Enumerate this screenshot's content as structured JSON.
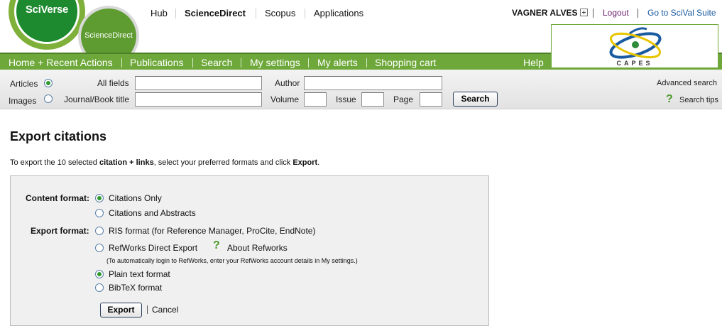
{
  "logos": {
    "sciverse": "SciVerse",
    "sciencedirect": "ScienceDirect",
    "capes": "CAPES"
  },
  "topnav": {
    "items": [
      "Hub",
      "ScienceDirect",
      "Scopus",
      "Applications"
    ],
    "active": "ScienceDirect"
  },
  "user": {
    "name": "VAGNER ALVES",
    "expand_icon": "plus-box-icon",
    "logout": "Logout",
    "scival": "Go to SciVal Suite"
  },
  "menu": {
    "items": [
      "Home + Recent Actions",
      "Publications",
      "Search",
      "My settings",
      "My alerts",
      "Shopping cart"
    ],
    "help": "Help"
  },
  "search": {
    "type_articles": "Articles",
    "type_images": "Images",
    "selected_type": "Articles",
    "all_fields_label": "All fields",
    "author_label": "Author",
    "journal_label": "Journal/Book title",
    "volume_label": "Volume",
    "issue_label": "Issue",
    "page_label": "Page",
    "search_button": "Search",
    "advanced": "Advanced search",
    "tips": "Search tips",
    "all_fields_value": "",
    "author_value": "",
    "journal_value": "",
    "volume_value": "",
    "issue_value": "",
    "page_value": ""
  },
  "export": {
    "title": "Export citations",
    "intro_prefix": "To export the 10 selected ",
    "intro_bold": "citation + links",
    "intro_middle": ", select your preferred formats and click ",
    "intro_export": "Export",
    "intro_end": ".",
    "content_format_label": "Content format:",
    "content_options": [
      "Citations Only",
      "Citations and Abstracts"
    ],
    "content_selected": "Citations Only",
    "export_format_label": "Export format:",
    "export_options": [
      "RIS format (for Reference Manager, ProCite, EndNote)",
      "RefWorks Direct Export",
      "Plain text format",
      "BibTeX format"
    ],
    "export_selected": "Plain text format",
    "about_refworks": "About Refworks",
    "refworks_note": "(To automatically login to RefWorks, enter your RefWorks account details in My settings.)",
    "export_button": "Export",
    "cancel": "Cancel"
  },
  "colors": {
    "menu_green": "#6ea83a",
    "link_blue": "#1a5aa0",
    "link_purple": "#6b1e6e"
  }
}
